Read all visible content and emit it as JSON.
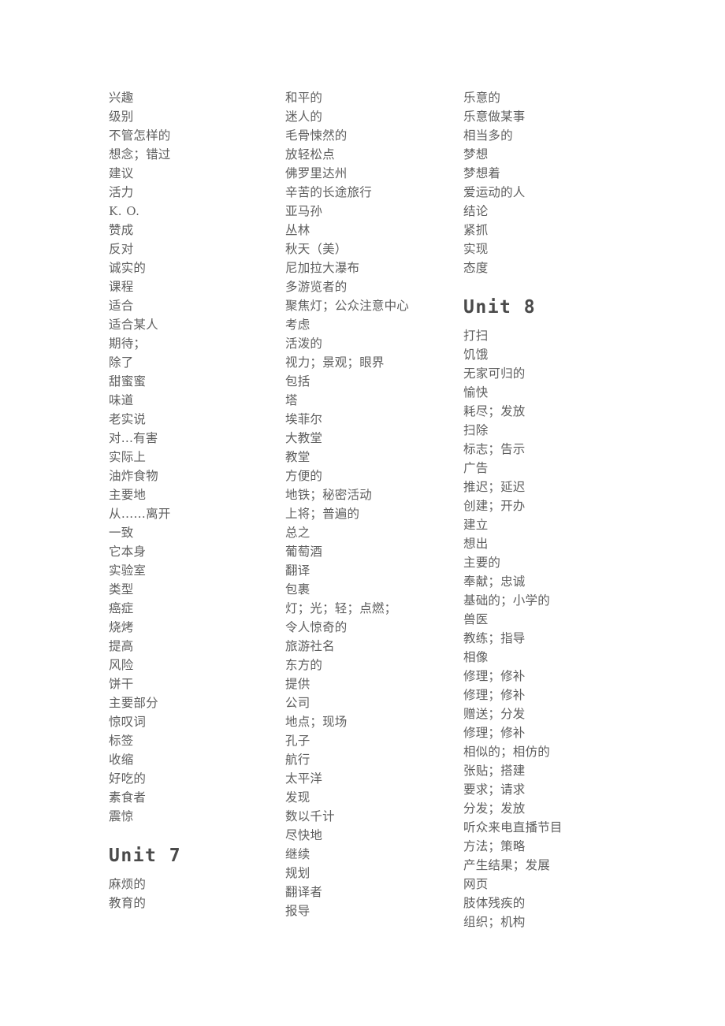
{
  "document": {
    "type": "vocabulary-word-list",
    "language": "zh-CN",
    "page_background": "#ffffff",
    "text_color": "#5e5e5e",
    "column_count": 3
  },
  "headings": {
    "unit7": "Unit 7",
    "unit8": "Unit 8"
  },
  "columns": [
    {
      "id": "column-left",
      "blocks": [
        {
          "kind": "entries",
          "items": [
            "兴趣",
            "级别",
            "不管怎样的",
            "想念；错过",
            "建议",
            "活力",
            "K. O.",
            "赞成",
            "反对",
            "诚实的",
            "课程",
            "适合",
            "适合某人",
            "期待；",
            "除了",
            "甜蜜蜜",
            "味道",
            "老实说",
            "对...有害",
            "实际上",
            "油炸食物",
            "主要地",
            "从……离开",
            "一致",
            "它本身",
            "实验室",
            "类型",
            "癌症",
            "烧烤",
            "提高",
            "风险",
            "饼干",
            "主要部分",
            "惊叹词",
            "标签",
            "收缩",
            "好吃的",
            "素食者",
            "震惊"
          ]
        },
        {
          "kind": "heading",
          "text": "Unit 7"
        },
        {
          "kind": "entries",
          "items": [
            "麻烦的",
            "教育的"
          ]
        }
      ]
    },
    {
      "id": "column-middle",
      "blocks": [
        {
          "kind": "entries",
          "items": [
            "和平的",
            "迷人的",
            "毛骨悚然的",
            "放轻松点",
            "佛罗里达州",
            "辛苦的长途旅行",
            "亚马孙",
            "丛林",
            "秋天（美）",
            "尼加拉大瀑布",
            "多游览者的",
            "聚焦灯；公众注意中心",
            "考虑",
            "活泼的",
            "视力；景观；眼界",
            "包括",
            "塔",
            "埃菲尔",
            "大教堂",
            "教堂",
            "方便的",
            "地铁；秘密活动",
            "上将；普遍的",
            "总之",
            "葡萄酒",
            "翻译",
            "包裹",
            "灯；光；轻；点燃；",
            "令人惊奇的",
            "旅游社名",
            "东方的",
            "提供",
            "公司",
            "地点；现场",
            "孔子",
            "航行",
            "太平洋",
            "发现",
            "数以千计",
            "尽快地",
            "继续",
            "规划",
            "翻译者",
            "报导"
          ]
        }
      ]
    },
    {
      "id": "column-right",
      "blocks": [
        {
          "kind": "entries",
          "items": [
            "乐意的",
            "乐意做某事",
            "相当多的",
            "梦想",
            "梦想着",
            "爱运动的人",
            "结论",
            "紧抓",
            "实现",
            "态度"
          ]
        },
        {
          "kind": "heading",
          "text": "Unit 8"
        },
        {
          "kind": "entries",
          "items": [
            "打扫",
            "饥饿",
            "无家可归的",
            "愉快",
            "耗尽；发放",
            "扫除",
            "标志；告示",
            "广告",
            "推迟；延迟",
            "创建；开办",
            "建立",
            "想出",
            "主要的",
            "奉献；忠诚",
            "基础的；小学的",
            "兽医",
            "教练；指导",
            "相像",
            "修理；修补",
            "修理；修补",
            "赠送；分发",
            "修理；修补",
            "相似的；相仿的",
            "张贴；搭建",
            "要求；请求",
            "分发；发放",
            "听众来电直播节目",
            "方法；策略",
            "产生结果；发展",
            "网页",
            "肢体残疾的",
            "组织；机构"
          ]
        }
      ]
    }
  ]
}
